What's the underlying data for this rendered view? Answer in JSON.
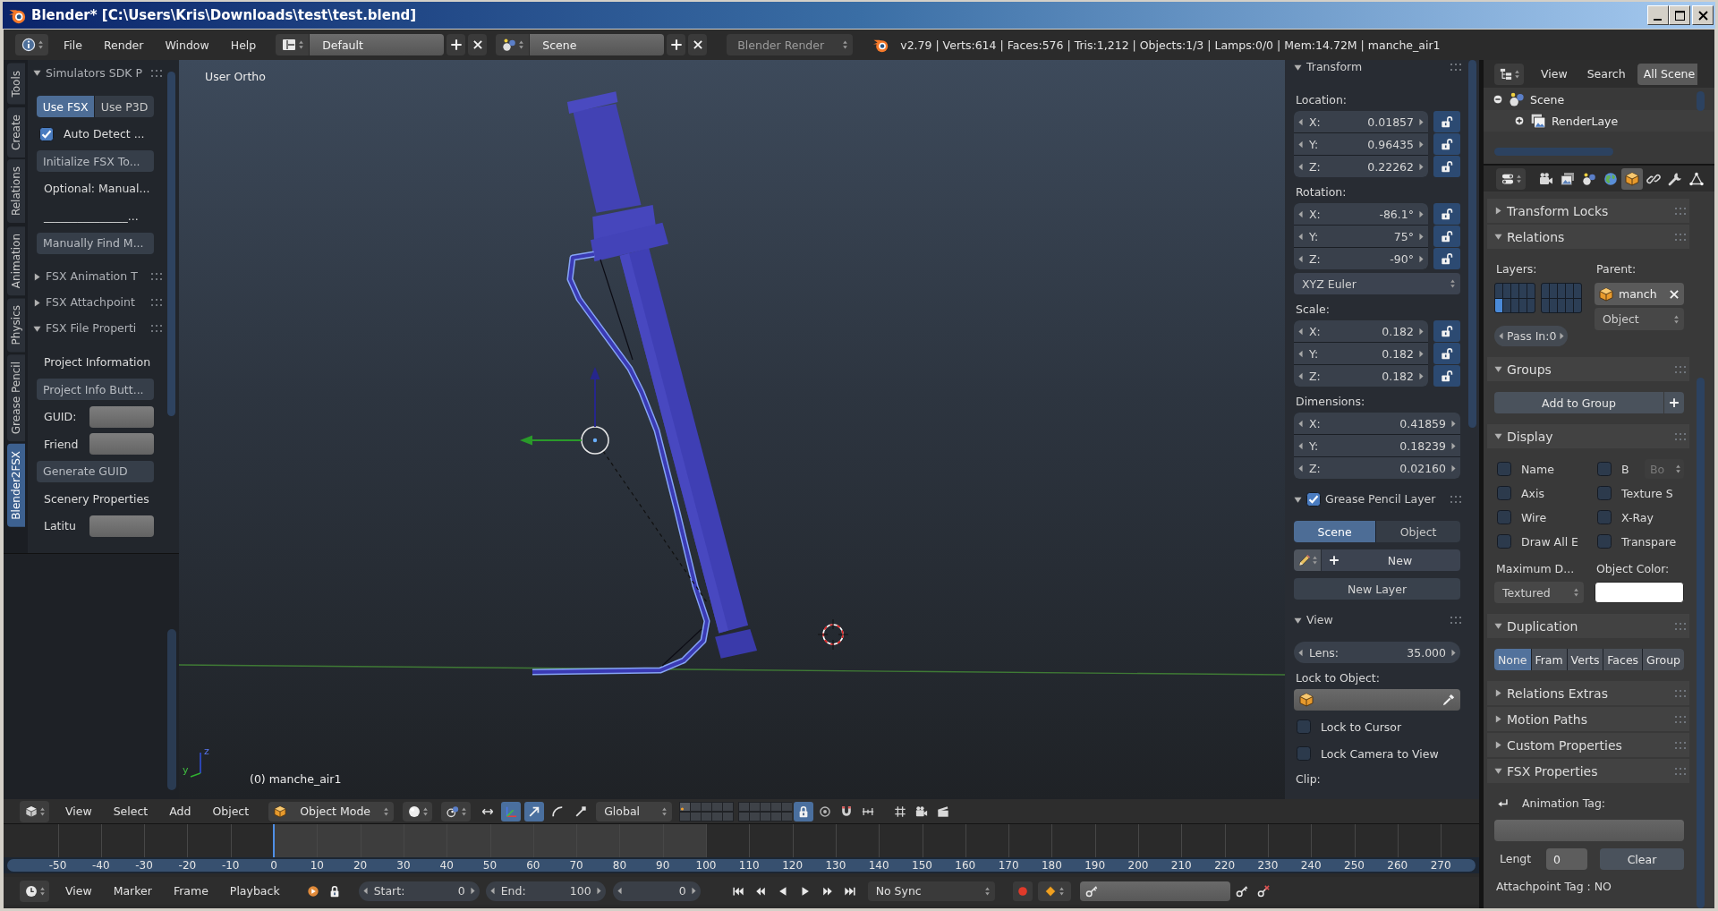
{
  "window": {
    "title": "Blender* [C:\\Users\\Kris\\Downloads\\test\\test.blend]"
  },
  "info_header": {
    "menus": [
      "File",
      "Render",
      "Window",
      "Help"
    ],
    "layout": "Default",
    "scene": "Scene",
    "engine": "Blender Render",
    "stats": "v2.79 | Verts:614 | Faces:576 | Tris:1,212 | Objects:1/3 | Lamps:0/0 | Mem:14.72M | manche_air1"
  },
  "tool_shelf": {
    "tabs": [
      {
        "label": "Tools",
        "selected": false
      },
      {
        "label": "Create",
        "selected": false
      },
      {
        "label": "Relations",
        "selected": false
      },
      {
        "label": "Animation",
        "selected": false
      },
      {
        "label": "Physics",
        "selected": false
      },
      {
        "label": "Grease Pencil",
        "selected": false
      },
      {
        "label": "Blender2FSX",
        "selected": true
      }
    ],
    "panels": [
      {
        "title": "Simulators SDK P",
        "expanded": true,
        "rows": [
          {
            "kind": "toggle",
            "options": [
              {
                "text": "Use FSX",
                "selected": true
              },
              {
                "text": "Use P3D",
                "selected": false
              }
            ]
          },
          {
            "kind": "checkbox",
            "text": "Auto Detect ...",
            "checked": true
          },
          {
            "kind": "button",
            "text": "Initialize FSX To..."
          },
          {
            "kind": "label",
            "text": "Optional: Manual..."
          },
          {
            "kind": "label",
            "text": "_______________..."
          },
          {
            "kind": "button",
            "text": "Manually Find M..."
          }
        ]
      },
      {
        "title": "FSX Animation T",
        "expanded": false
      },
      {
        "title": "FSX Attachpoint",
        "expanded": false
      },
      {
        "title": "FSX File Properti",
        "expanded": true,
        "rows": [
          {
            "kind": "label",
            "text": "Project Information"
          },
          {
            "kind": "button",
            "text": "Project Info Butt..."
          },
          {
            "kind": "field",
            "text": "GUID:"
          },
          {
            "kind": "field",
            "text": "Friend"
          },
          {
            "kind": "button",
            "text": "Generate GUID"
          },
          {
            "kind": "label",
            "text": "Scenery Properties"
          },
          {
            "kind": "field",
            "text": "Latitu"
          }
        ]
      }
    ]
  },
  "viewport": {
    "view_name": "User Ortho",
    "object_label": "(0) manche_air1",
    "axis_labels": [
      "y",
      "z"
    ]
  },
  "n_panel": {
    "panels": [
      {
        "title": "Transform",
        "expanded": true,
        "rows": [
          {
            "kind": "label",
            "text": "Location:"
          },
          {
            "kind": "vector",
            "fields": [
              {
                "axis": "X:",
                "value": "0.01857",
                "locked": false
              },
              {
                "axis": "Y:",
                "value": "0.96435",
                "locked": false
              },
              {
                "axis": "Z:",
                "value": "0.22262",
                "locked": false
              }
            ]
          },
          {
            "kind": "label",
            "text": "Rotation:"
          },
          {
            "kind": "vector",
            "fields": [
              {
                "axis": "X:",
                "value": "-86.1°",
                "locked": false
              },
              {
                "axis": "Y:",
                "value": "75°",
                "locked": false
              },
              {
                "axis": "Z:",
                "value": "-90°",
                "locked": false
              }
            ]
          },
          {
            "kind": "dropdown",
            "text": "XYZ Euler"
          },
          {
            "kind": "label",
            "text": "Scale:"
          },
          {
            "kind": "vector",
            "fields": [
              {
                "axis": "X:",
                "value": "0.182",
                "locked": false
              },
              {
                "axis": "Y:",
                "value": "0.182",
                "locked": false
              },
              {
                "axis": "Z:",
                "value": "0.182",
                "locked": false
              }
            ]
          },
          {
            "kind": "label",
            "text": "Dimensions:"
          },
          {
            "kind": "vector",
            "fields": [
              {
                "axis": "X:",
                "value": "0.41859"
              },
              {
                "axis": "Y:",
                "value": "0.18239"
              },
              {
                "axis": "Z:",
                "value": "0.02160"
              }
            ]
          }
        ]
      },
      {
        "title": "Grease Pencil Layer",
        "expanded": true,
        "checked": true,
        "rows": [
          {
            "kind": "toggle",
            "options": [
              {
                "text": "Scene",
                "selected": true
              },
              {
                "text": "Object",
                "selected": false
              }
            ]
          },
          {
            "kind": "new",
            "text": "New"
          },
          {
            "kind": "button",
            "text": "New Layer"
          }
        ]
      },
      {
        "title": "View",
        "expanded": true,
        "rows": [
          {
            "kind": "number",
            "text": "Lens:",
            "value": "35.000"
          },
          {
            "kind": "label",
            "text": "Lock to Object:"
          },
          {
            "kind": "object_field"
          },
          {
            "kind": "checkbox",
            "text": "Lock to Cursor",
            "checked": false
          },
          {
            "kind": "checkbox",
            "text": "Lock Camera to View",
            "checked": false
          },
          {
            "kind": "label",
            "text": "Clip:"
          }
        ]
      }
    ]
  },
  "view3d_header": {
    "menus": [
      "View",
      "Select",
      "Add",
      "Object"
    ],
    "mode": "Object Mode",
    "manipulator": {
      "on": true
    },
    "transform_tools": [
      {
        "kind": "translate",
        "selected": true
      },
      {
        "kind": "rotate",
        "selected": false
      },
      {
        "kind": "scale",
        "selected": false
      }
    ],
    "orientation": "Global",
    "lock_layers": {
      "on": true
    }
  },
  "timeline": {
    "ticks": [
      "-50",
      "-40",
      "-30",
      "-20",
      "-10",
      "0",
      "10",
      "20",
      "30",
      "40",
      "50",
      "60",
      "70",
      "80",
      "90",
      "100",
      "110",
      "120",
      "130",
      "140",
      "150",
      "160",
      "170",
      "180",
      "190",
      "200",
      "210",
      "220",
      "230",
      "240",
      "250",
      "260",
      "270"
    ]
  },
  "timeline_header": {
    "menus": [
      "View",
      "Marker",
      "Frame",
      "Playback"
    ],
    "start_label": "Start:",
    "start": "0",
    "end_label": "End:",
    "end": "100",
    "frame": "0",
    "sync": "No Sync",
    "auto_keying": false
  },
  "outliner": {
    "menus": [
      "View",
      "Search"
    ],
    "filter": "All Scene",
    "tree": [
      {
        "text": "Scene",
        "expanded": true,
        "children": [
          {
            "text": "RenderLaye",
            "expanded": false
          }
        ]
      }
    ]
  },
  "properties": {
    "tabs": [
      {
        "kind": "render",
        "selected": false
      },
      {
        "kind": "render_layers",
        "selected": false
      },
      {
        "kind": "scene",
        "selected": false
      },
      {
        "kind": "world",
        "selected": false
      },
      {
        "kind": "object",
        "selected": true
      },
      {
        "kind": "constraints",
        "selected": false
      },
      {
        "kind": "modifiers",
        "selected": false
      },
      {
        "kind": "data",
        "selected": false
      }
    ],
    "panels": [
      {
        "title": "Transform Locks",
        "expanded": false
      },
      {
        "title": "Relations",
        "expanded": true,
        "rows": [
          {
            "kind": "relations",
            "layers_label": "Layers:",
            "layers": [
              false,
              false,
              false,
              false,
              false,
              false,
              false,
              false,
              false,
              false,
              true,
              false,
              false,
              false,
              false,
              false,
              false,
              false,
              false,
              false
            ],
            "parent_label": "Parent:",
            "parent": "manch",
            "parent_type": "Object",
            "pass_index": "Pass In:0"
          }
        ]
      },
      {
        "title": "Groups",
        "expanded": true,
        "rows": [
          {
            "kind": "add_button",
            "text": "Add to Group"
          }
        ]
      },
      {
        "title": "Display",
        "expanded": true,
        "rows": [
          {
            "kind": "check_grid",
            "items": [
              {
                "text": "Name",
                "checked": false
              },
              {
                "text": "B",
                "checked": false,
                "option": "Bo"
              },
              {
                "text": "Axis",
                "checked": false
              },
              {
                "text": "Texture S",
                "checked": false
              },
              {
                "text": "Wire",
                "checked": false
              },
              {
                "text": "X-Ray",
                "checked": false
              },
              {
                "text": "Draw All E",
                "checked": false
              },
              {
                "text": "Transpare",
                "checked": false
              }
            ]
          },
          {
            "kind": "draw_type",
            "text": "Maximum D...",
            "value": "Textured",
            "color_text": "Object Color:",
            "color": "#ffffff"
          }
        ]
      },
      {
        "title": "Duplication",
        "expanded": true,
        "rows": [
          {
            "kind": "toggle",
            "options": [
              {
                "text": "None",
                "selected": true
              },
              {
                "text": "Fram",
                "selected": false
              },
              {
                "text": "Verts",
                "selected": false
              },
              {
                "text": "Faces",
                "selected": false
              },
              {
                "text": "Group",
                "selected": false
              }
            ]
          }
        ]
      },
      {
        "title": "Relations Extras",
        "expanded": false
      },
      {
        "title": "Motion Paths",
        "expanded": false
      },
      {
        "title": "Custom Properties",
        "expanded": false
      },
      {
        "title": "FSX Properties",
        "expanded": true,
        "rows": [
          {
            "kind": "icon_label",
            "text": "Animation Tag:"
          },
          {
            "kind": "text_field"
          },
          {
            "kind": "length",
            "text": "Lengt",
            "value": "0",
            "button": "Clear"
          },
          {
            "kind": "label",
            "text": "Attachpoint Tag : NO"
          }
        ]
      }
    ]
  }
}
